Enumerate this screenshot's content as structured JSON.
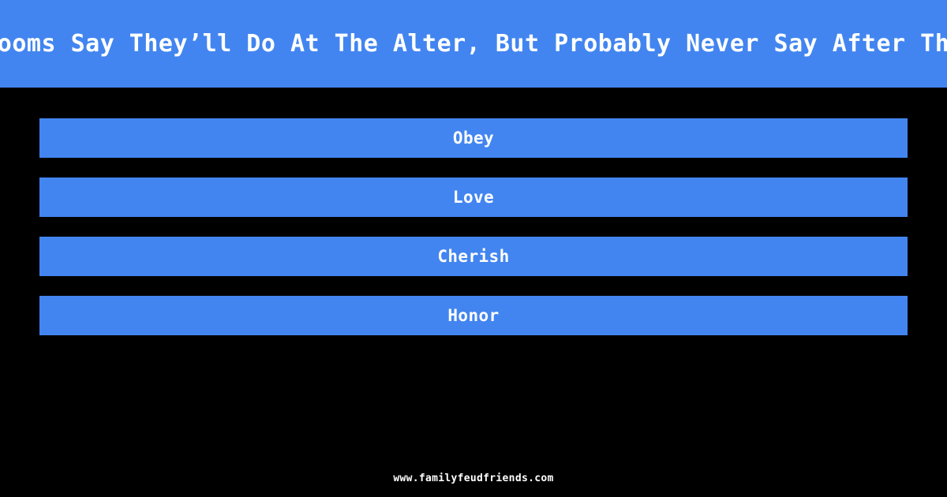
{
  "header": {
    "question": "A Word Grooms Say They’ll Do At The Alter, But Probably Never Say After The Wedding",
    "background_color": "#4285f0",
    "text_color": "#ffffff"
  },
  "answers": {
    "bar_color": "#4285f0",
    "text_color": "#ffffff",
    "items": [
      {
        "label": "Obey"
      },
      {
        "label": "Love"
      },
      {
        "label": "Cherish"
      },
      {
        "label": "Honor"
      }
    ]
  },
  "footer": {
    "site": "www.familyfeudfriends.com"
  },
  "theme": {
    "page_background": "#000000",
    "accent": "#4285f0"
  }
}
